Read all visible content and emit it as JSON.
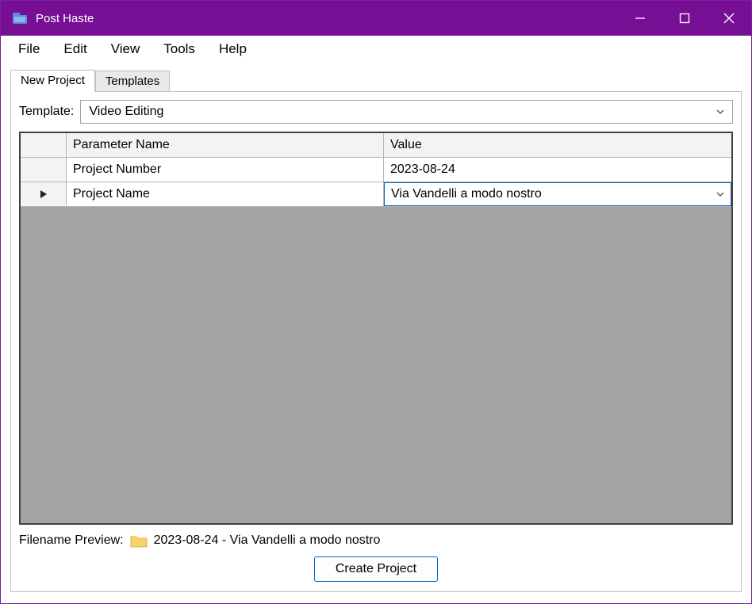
{
  "window": {
    "title": "Post Haste"
  },
  "menus": {
    "file": "File",
    "edit": "Edit",
    "view": "View",
    "tools": "Tools",
    "help": "Help"
  },
  "tabs": {
    "new_project": "New Project",
    "templates": "Templates"
  },
  "template": {
    "label": "Template:",
    "value": "Video Editing"
  },
  "grid": {
    "headers": {
      "param": "Parameter Name",
      "value": "Value"
    },
    "rows": [
      {
        "param": "Project Number",
        "value": "2023-08-24"
      },
      {
        "param": "Project Name",
        "value": "Via Vandelli a modo nostro"
      }
    ]
  },
  "preview": {
    "label": "Filename Preview:",
    "value": "2023-08-24 - Via Vandelli a modo nostro"
  },
  "buttons": {
    "create": "Create Project"
  }
}
